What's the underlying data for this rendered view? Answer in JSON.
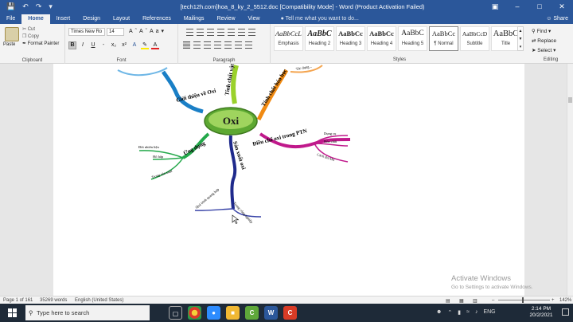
{
  "window": {
    "title": "[tech12h.com]hoa_8_ky_2_5512.doc [Compatibility Mode] - Word (Product Activation Failed)"
  },
  "tabs": [
    "File",
    "Home",
    "Insert",
    "Design",
    "Layout",
    "References",
    "Mailings",
    "Review",
    "View"
  ],
  "tell_me": "Tell me what you want to do...",
  "share": "Share",
  "clipboard": {
    "paste": "Paste",
    "cut": "Cut",
    "copy": "Copy",
    "format_painter": "Format Painter",
    "label": "Clipboard"
  },
  "font": {
    "name": "Times New Ro",
    "size": "14",
    "label": "Font"
  },
  "paragraph_label": "Paragraph",
  "styles": {
    "label": "Styles",
    "items": [
      {
        "sample": "AaBbCcL",
        "name": "Emphasis"
      },
      {
        "sample": "AaBbC",
        "name": "Heading 2"
      },
      {
        "sample": "AaBbCc",
        "name": "Heading 3"
      },
      {
        "sample": "AaBbCc",
        "name": "Heading 4"
      },
      {
        "sample": "AaBbC",
        "name": "Heading 5"
      },
      {
        "sample": "AaBbCc",
        "name": "¶ Normal"
      },
      {
        "sample": "AaBbCcD",
        "name": "Subtitle"
      },
      {
        "sample": "AaBbC",
        "name": "Title"
      }
    ]
  },
  "editing": {
    "find": "Find",
    "replace": "Replace",
    "select": "Select",
    "label": "Editing"
  },
  "mindmap": {
    "center": "Oxi",
    "branches": {
      "intro": "Giới thiệu về Oxi",
      "physical": "Tính chất vật lí",
      "chemical": "Tính chất hóa học",
      "lab": "Điều chế oxi trong PTN",
      "production": "Sản xuất oxi",
      "application": "Ứng dụng"
    },
    "sub": {
      "tools": "Dụng cụ",
      "chemicals": "Hóa chất",
      "collect": "Cách thu khí",
      "nature": "Đốt nhiên liệu",
      "breathing": "Hô hấp",
      "industry_use": "Trong sản xuất",
      "lab_process": "Quá trình quang hợp",
      "industry": "Trong công nghiệp",
      "top_chem": "Tác dụng..."
    }
  },
  "activation": {
    "line1": "Activate Windows",
    "line2": "Go to Settings to activate Windows."
  },
  "status": {
    "page": "Page 1 of 161",
    "words": "35269 words",
    "language": "English (United States)",
    "zoom": "142%"
  },
  "taskbar": {
    "search_placeholder": "Type here to search",
    "language": "ENG",
    "time": "2:14 PM",
    "date": "20/2/2021"
  },
  "colors": {
    "word_blue": "#2b579a",
    "center_node": "#7ac043",
    "branch_intro": "#1a7fc6",
    "branch_physical": "#9ad12b",
    "branch_chemical": "#f08a12",
    "branch_lab": "#c0198b",
    "branch_production": "#1f2a8c",
    "branch_application": "#23a84a"
  }
}
